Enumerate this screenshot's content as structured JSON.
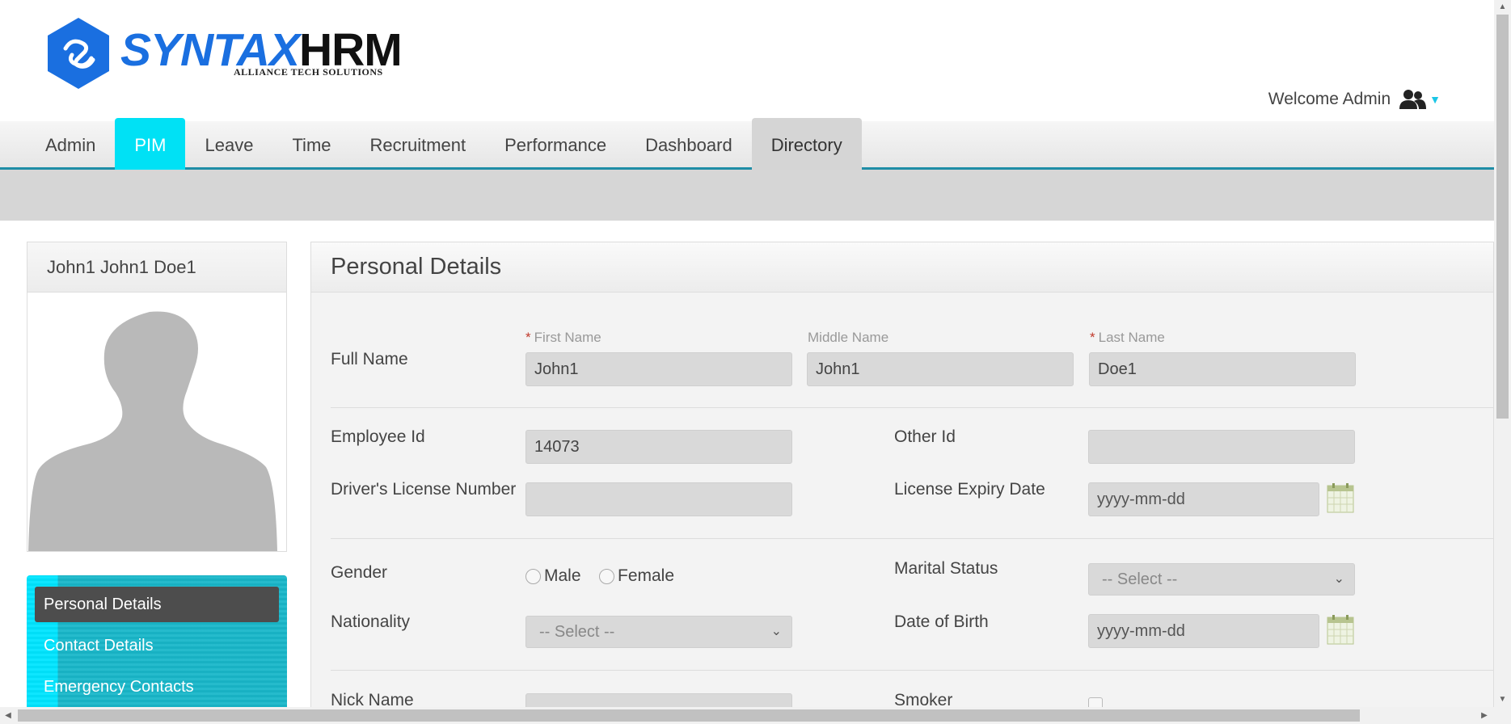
{
  "brand": {
    "syntax": "SYNTAX",
    "hrm": "HRM",
    "subtitle": "ALLIANCE TECH SOLUTIONS"
  },
  "header": {
    "welcome": "Welcome Admin",
    "user_icon": "users-icon"
  },
  "nav": {
    "items": [
      "Admin",
      "PIM",
      "Leave",
      "Time",
      "Recruitment",
      "Performance",
      "Dashboard",
      "Directory"
    ],
    "active": "PIM",
    "hovered": "Directory"
  },
  "profile": {
    "name": "John1 John1 Doe1"
  },
  "side_menu": {
    "items": [
      "Personal Details",
      "Contact Details",
      "Emergency Contacts"
    ],
    "current": "Personal Details"
  },
  "panel": {
    "title": "Personal Details",
    "full_name": {
      "label": "Full Name",
      "first_label": "First Name",
      "first_value": "John1",
      "middle_label": "Middle Name",
      "middle_value": "John1",
      "last_label": "Last Name",
      "last_value": "Doe1",
      "required_mark": "*"
    },
    "employee_id": {
      "label": "Employee Id",
      "value": "14073"
    },
    "other_id": {
      "label": "Other Id",
      "value": ""
    },
    "drivers_license": {
      "label": "Driver's License Number",
      "value": ""
    },
    "license_expiry": {
      "label": "License Expiry Date",
      "value": "yyyy-mm-dd"
    },
    "gender": {
      "label": "Gender",
      "options": [
        "Male",
        "Female"
      ]
    },
    "marital_status": {
      "label": "Marital Status",
      "value": "-- Select --"
    },
    "nationality": {
      "label": "Nationality",
      "value": "-- Select --"
    },
    "dob": {
      "label": "Date of Birth",
      "value": "yyyy-mm-dd"
    },
    "nick_name": {
      "label": "Nick Name",
      "value": ""
    },
    "smoker": {
      "label": "Smoker"
    }
  },
  "colors": {
    "accent": "#00e1f5",
    "nav_border": "#1f8da6",
    "brand_blue": "#1a6fe0",
    "menu_dark": "#4d4d4d"
  }
}
